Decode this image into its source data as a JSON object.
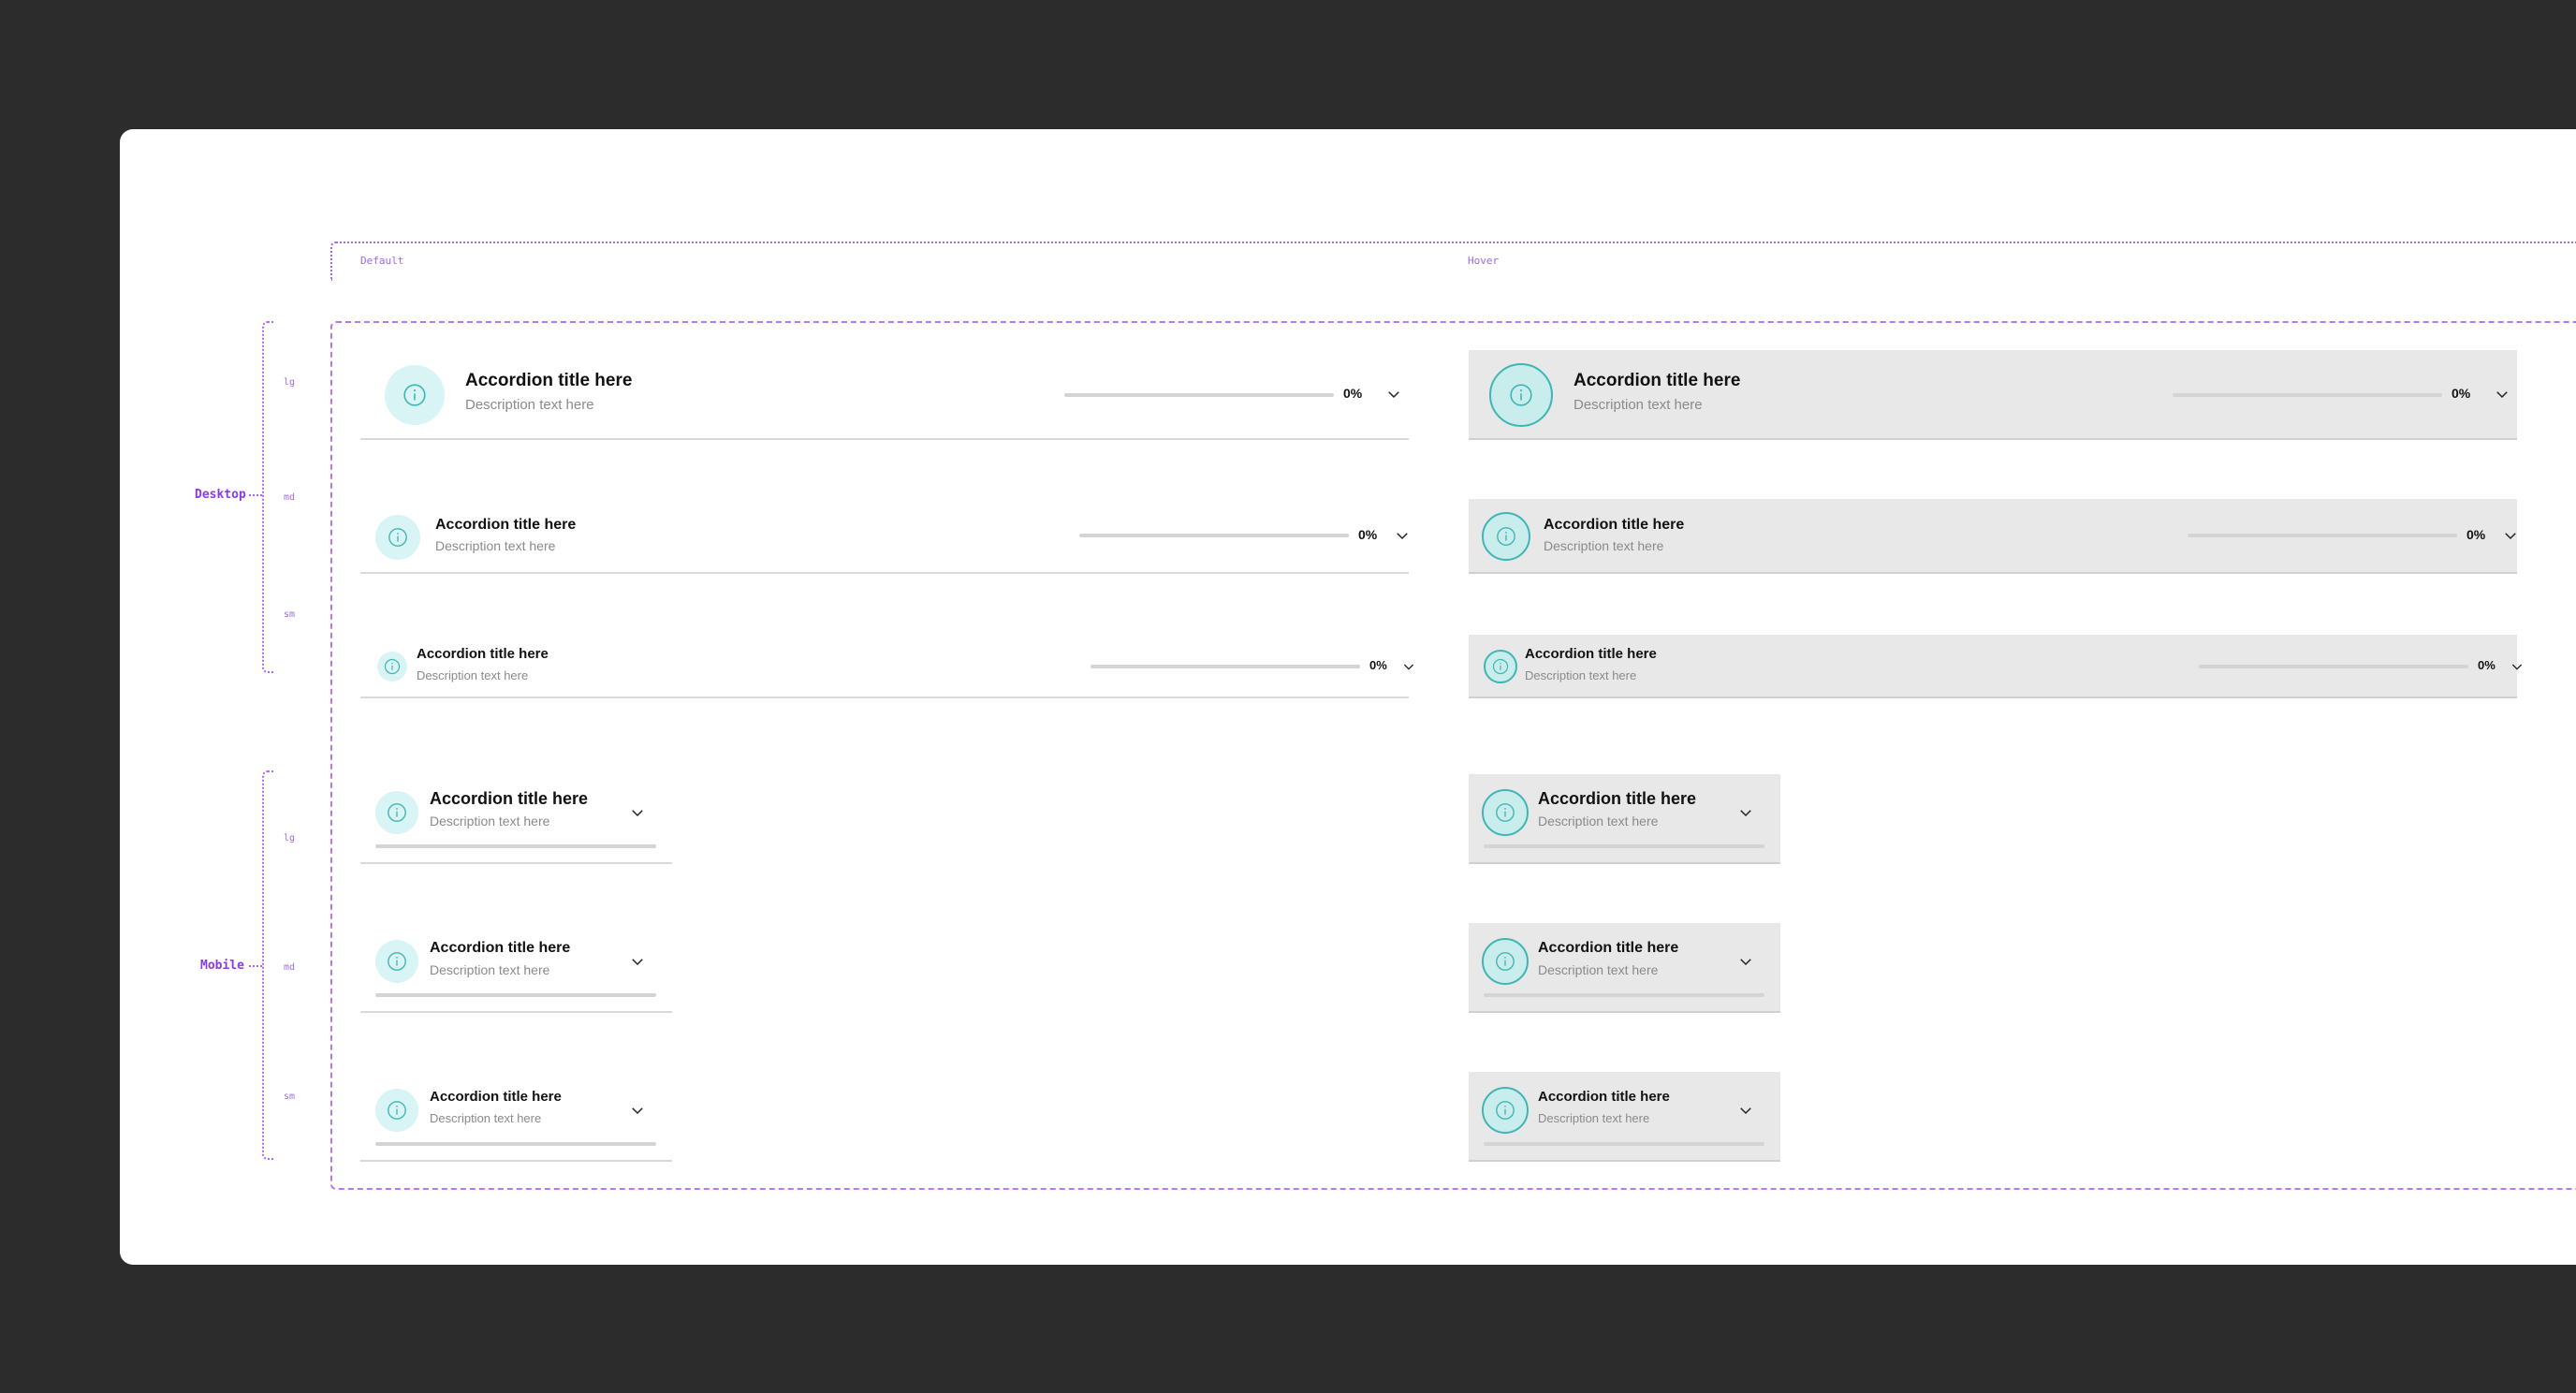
{
  "columns": {
    "default": "Default",
    "hover": "Hover"
  },
  "groups": {
    "desktop": "Desktop",
    "mobile": "Mobile"
  },
  "sizes": {
    "lg": "lg",
    "md": "md",
    "sm": "sm"
  },
  "accordion": {
    "title": "Accordion title here",
    "description": "Description text here",
    "progress_label": "0%",
    "progress_value": 0
  },
  "icons": {
    "info": "info-icon",
    "chevron": "chevron-down-icon"
  },
  "colors": {
    "background": "#2c2c2c",
    "canvas": "#ffffff",
    "annotation": "#a66cf0",
    "icon_bg": "#d9f4f5",
    "icon_accent": "#3fb6b3",
    "hover_bg": "#e8e8e8",
    "divider": "#d9d9d9"
  }
}
